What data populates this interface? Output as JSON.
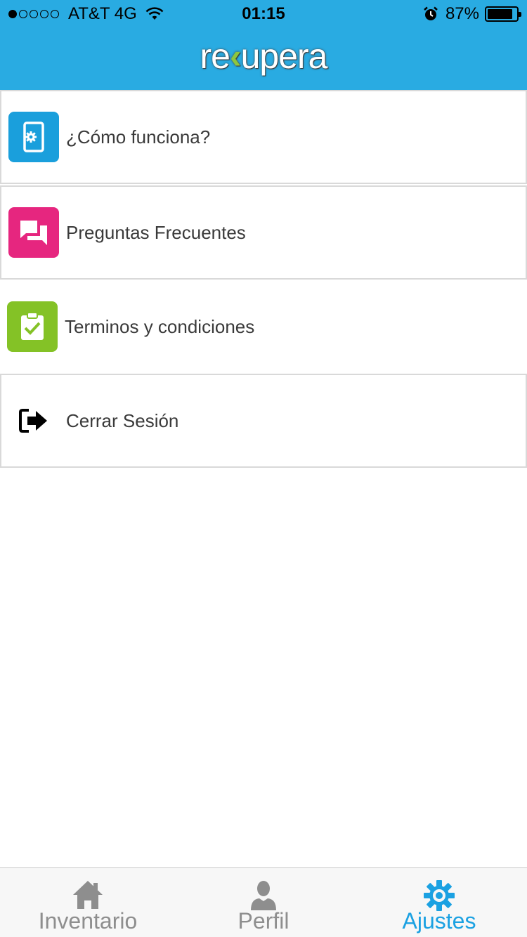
{
  "status_bar": {
    "carrier": "AT&T 4G",
    "time": "01:15",
    "battery_percent": "87%",
    "battery_level": 0.87,
    "signal_dots_filled": 1,
    "signal_dots_total": 5
  },
  "header": {
    "logo_text_start": "re",
    "logo_text_end": "upera",
    "background_color": "#29abe2"
  },
  "menu": {
    "items": [
      {
        "label": "¿Cómo funciona?",
        "icon": "phone-settings-icon",
        "color": "#1a9fdc"
      },
      {
        "label": "Preguntas Frecuentes",
        "icon": "chat-bubbles-icon",
        "color": "#e6267f"
      },
      {
        "label": "Terminos y condiciones",
        "icon": "clipboard-check-icon",
        "color": "#84c226"
      },
      {
        "label": "Cerrar Sesión",
        "icon": "logout-icon",
        "color": "#000000"
      }
    ]
  },
  "tabs": [
    {
      "label": "Inventario",
      "icon": "home-icon",
      "active": false
    },
    {
      "label": "Perfil",
      "icon": "person-icon",
      "active": false
    },
    {
      "label": "Ajustes",
      "icon": "gear-icon",
      "active": true
    }
  ],
  "colors": {
    "active_tab": "#1ba1e2",
    "inactive_tab": "#8e8e8e"
  }
}
